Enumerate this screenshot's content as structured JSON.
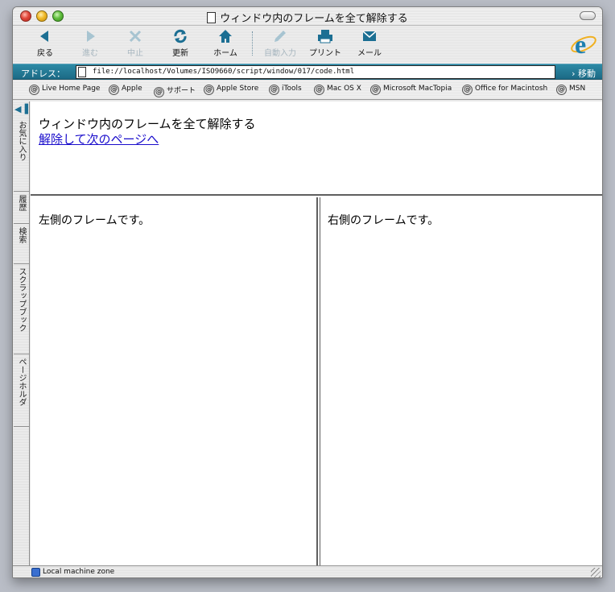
{
  "window": {
    "title": "ウィンドウ内のフレームを全て解除する"
  },
  "toolbar": {
    "back": {
      "label": "戻る",
      "icon": "back-arrow-icon"
    },
    "forward": {
      "label": "進む",
      "icon": "forward-arrow-icon",
      "enabled": false
    },
    "stop": {
      "label": "中止",
      "icon": "stop-x-icon",
      "enabled": false
    },
    "refresh": {
      "label": "更新",
      "icon": "refresh-icon"
    },
    "home": {
      "label": "ホーム",
      "icon": "home-icon"
    },
    "autofill": {
      "label": "自動入力",
      "icon": "autofill-pen-icon",
      "enabled": false
    },
    "print": {
      "label": "プリント",
      "icon": "printer-icon"
    },
    "mail": {
      "label": "メール",
      "icon": "mail-icon"
    }
  },
  "addressbar": {
    "label": "アドレス：",
    "url": "file://localhost/Volumes/ISO9660/script/window/017/code.html",
    "go_label": "移動"
  },
  "favorites": [
    "Live Home Page",
    "Apple",
    "サポート",
    "Apple Store",
    "iTools",
    "Mac OS X",
    "Microsoft MacTopia",
    "Office for Macintosh",
    "MSN"
  ],
  "sidebar": {
    "tabs": [
      "お気に入り",
      "履歴",
      "検索",
      "スクラップブック",
      "ページホルダ"
    ]
  },
  "content": {
    "top_heading": "ウィンドウ内のフレームを全て解除する",
    "top_link": "解除して次のページへ",
    "left_frame_text": "左側のフレームです。",
    "right_frame_text": "右側のフレームです。"
  },
  "status": {
    "zone": "Local machine zone"
  },
  "colors": {
    "accent": "#1c6f93",
    "link": "#1a0dcc",
    "address_bar": "#2d8aa6"
  }
}
